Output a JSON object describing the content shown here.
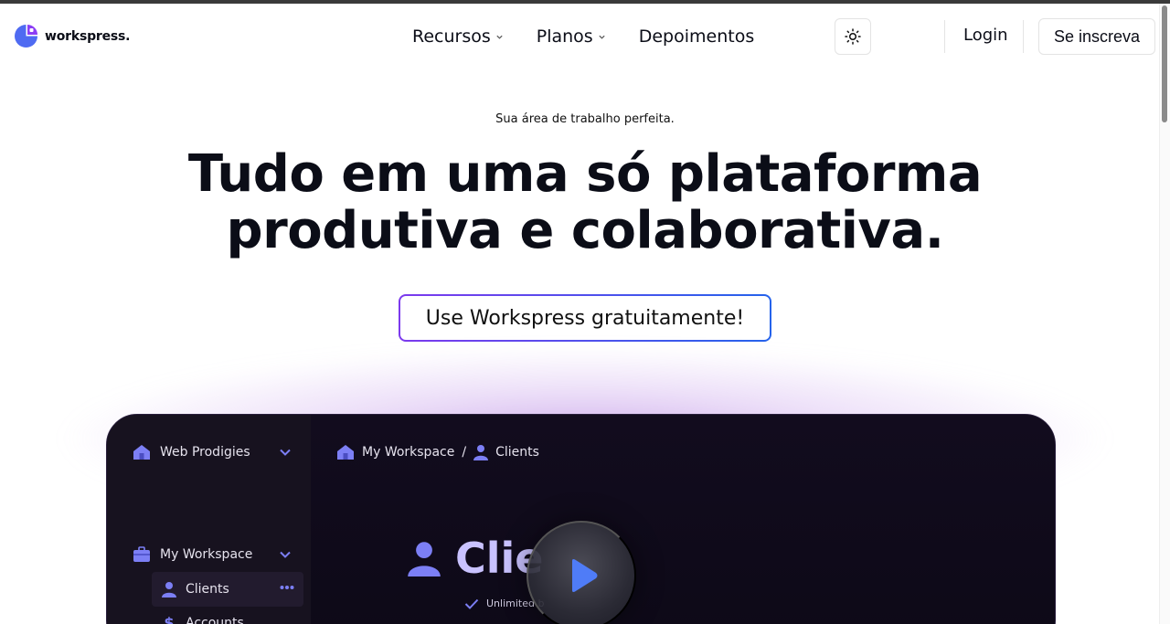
{
  "brand": {
    "name": "workspress."
  },
  "nav": {
    "items": [
      {
        "label": "Recursos",
        "has_dropdown": true
      },
      {
        "label": "Planos",
        "has_dropdown": true
      },
      {
        "label": "Depoimentos",
        "has_dropdown": false
      }
    ],
    "theme_icon": "sun-icon",
    "login_label": "Login",
    "signup_label": "Se inscreva"
  },
  "hero": {
    "eyebrow": "Sua área de trabalho perfeita.",
    "title_line1": "Tudo em uma só plataforma",
    "title_line2": "produtiva e colaborativa.",
    "cta_label": "Use Workspress gratuitamente!"
  },
  "preview": {
    "sidebar": {
      "workspace_switcher": "Web Prodigies",
      "section": "My Workspace",
      "items": [
        {
          "label": "Clients",
          "icon": "user-icon",
          "active": true
        },
        {
          "label": "Accounts",
          "icon": "dollar-icon",
          "active": false
        }
      ]
    },
    "breadcrumb": {
      "root": "My Workspace",
      "separator": "/",
      "current": "Clients"
    },
    "page_title": "Clie",
    "subtitle": "Unlimited b",
    "play_icon": "play-icon"
  },
  "colors": {
    "accent_purple": "#7c3aed",
    "accent_blue": "#2563eb",
    "preview_bg": "#0f0a1c",
    "preview_icon": "#7c7ff5"
  }
}
